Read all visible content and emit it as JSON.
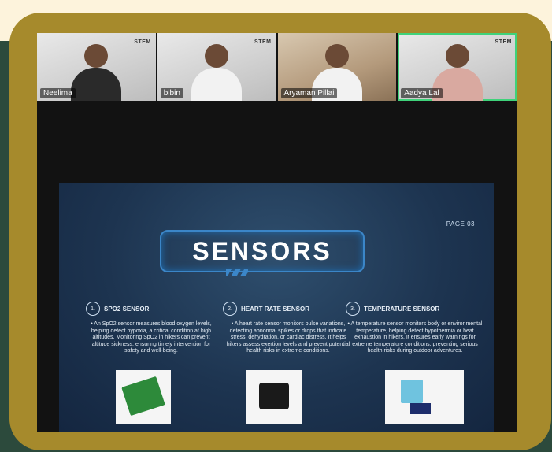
{
  "participants": [
    {
      "name": "Neelima",
      "logo": "STEM"
    },
    {
      "name": "bibin",
      "logo": "STEM"
    },
    {
      "name": "Aryaman Pillai",
      "logo": ""
    },
    {
      "name": "Aadya Lal",
      "logo": "STEM"
    }
  ],
  "slide": {
    "page": "PAGE 03",
    "title": "SENSORS",
    "columns": [
      {
        "num": "1.",
        "title": "SPO2 SENSOR",
        "desc": "• An SpO2 sensor measures blood oxygen levels, helping detect hypoxia, a critical condition at high altitudes. Monitoring SpO2 in hikers can prevent altitude sickness, ensuring timely intervention for safety and well-being."
      },
      {
        "num": "2.",
        "title": "HEART RATE SENSOR",
        "desc": "• A heart rate sensor monitors pulse variations, detecting abnormal spikes or drops that indicate stress, dehydration, or cardiac distress. It helps hikers assess exertion levels and prevent potential health risks in extreme conditions."
      },
      {
        "num": "3.",
        "title": "TEMPERATURE SENSOR",
        "desc": "• A temperature sensor monitors body or environmental temperature, helping detect hypothermia or heat exhaustion in hikers. It ensures early warnings for extreme temperature conditions, preventing serious health risks during outdoor adventures."
      }
    ]
  }
}
